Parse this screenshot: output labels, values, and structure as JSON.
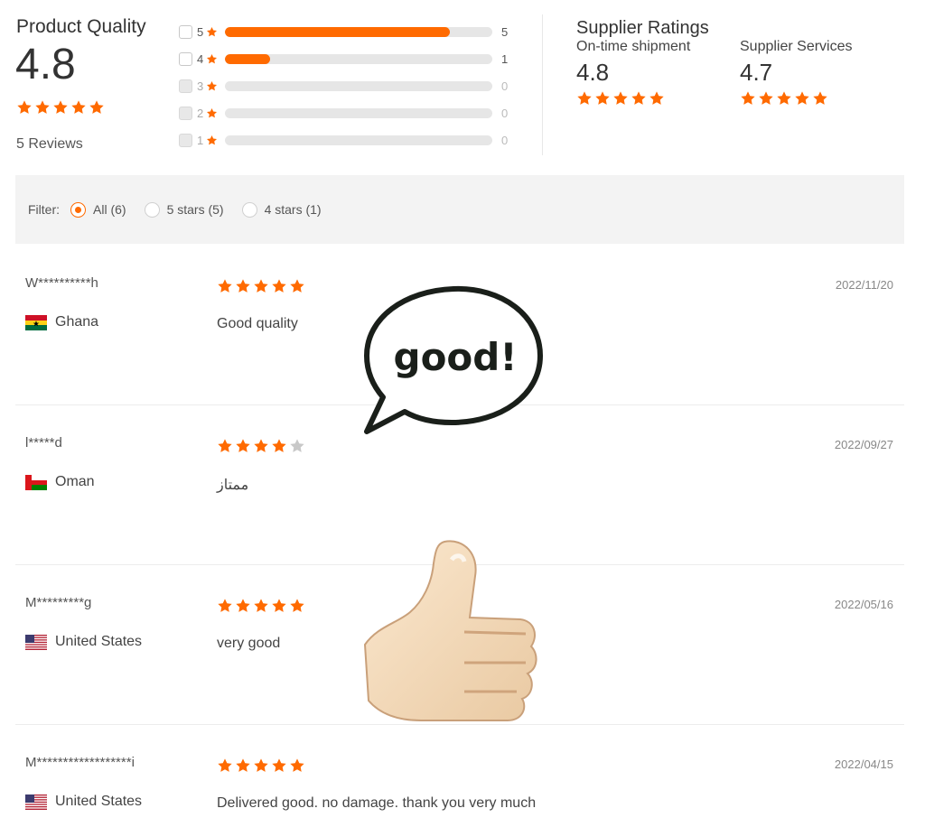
{
  "colors": {
    "accent": "#ff6a00",
    "star_empty": "#c8c8c8"
  },
  "product_quality": {
    "title": "Product Quality",
    "score": "4.8",
    "reviews_label": "5 Reviews",
    "distribution": [
      {
        "level": "5",
        "count": "5",
        "fraction": 0.84
      },
      {
        "level": "4",
        "count": "1",
        "fraction": 0.17
      },
      {
        "level": "3",
        "count": "0",
        "fraction": 0
      },
      {
        "level": "2",
        "count": "0",
        "fraction": 0
      },
      {
        "level": "1",
        "count": "0",
        "fraction": 0
      }
    ]
  },
  "supplier_ratings": {
    "title": "Supplier Ratings",
    "items": [
      {
        "label": "On-time shipment",
        "value": "4.8"
      },
      {
        "label": "Supplier Services",
        "value": "4.7"
      }
    ]
  },
  "filter": {
    "label": "Filter:",
    "options": [
      {
        "label": "All (6)",
        "checked": true
      },
      {
        "label": "5 stars (5)",
        "checked": false
      },
      {
        "label": "4 stars (1)",
        "checked": false
      }
    ]
  },
  "reviews": [
    {
      "user": "W**********h",
      "country": "Ghana",
      "flag": "ghana-flag-icon",
      "stars": 5,
      "comment": "Good quality",
      "date": "2022/11/20"
    },
    {
      "user": "l*****d",
      "country": "Oman",
      "flag": "oman-flag-icon",
      "stars": 4,
      "comment": "ممتاز",
      "date": "2022/09/27"
    },
    {
      "user": "M*********g",
      "country": "United States",
      "flag": "us-flag-icon",
      "stars": 5,
      "comment": "very good",
      "date": "2022/05/16"
    },
    {
      "user": "M******************i",
      "country": "United States",
      "flag": "us-flag-icon",
      "stars": 5,
      "comment": "Delivered good. no damage. thank you very much",
      "date": "2022/04/15"
    }
  ],
  "stickers": {
    "speech_text": "good!"
  }
}
